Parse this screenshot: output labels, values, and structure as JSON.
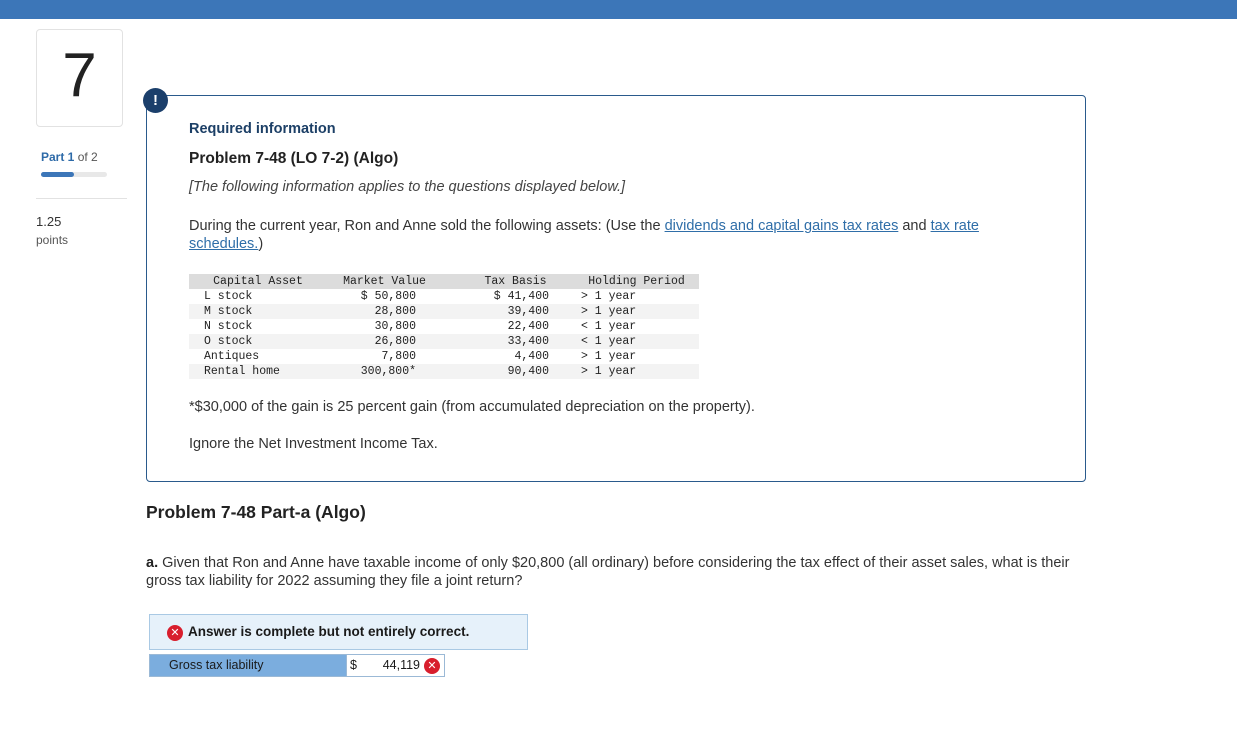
{
  "header": {
    "accent_color": "#3c76b8"
  },
  "sidebar": {
    "question_number": "7",
    "part_word": "Part 1",
    "part_of": "of 2",
    "progress_fraction": 0.5,
    "points_value": "1.25",
    "points_unit": "points"
  },
  "info": {
    "alert_symbol": "!",
    "required_title": "Required information",
    "problem_title": "Problem 7-48 (LO 7-2) (Algo)",
    "applies_note": "[The following information applies to the questions displayed below.]",
    "intro_before": "During the current year, Ron and Anne sold the following assets: (Use the ",
    "link_rates": "dividends and capital gains tax rates",
    "intro_between": " and ",
    "link_schedules": "tax rate schedules.",
    "intro_after": ")",
    "table": {
      "headers": [
        "Capital Asset",
        "Market Value",
        "Tax Basis",
        "Holding Period"
      ],
      "rows": [
        [
          "L stock",
          "$ 50,800",
          "$ 41,400",
          "> 1 year"
        ],
        [
          "M stock",
          "28,800",
          "39,400",
          "> 1 year"
        ],
        [
          "N stock",
          "30,800",
          "22,400",
          "< 1 year"
        ],
        [
          "O stock",
          "26,800",
          "33,400",
          "< 1 year"
        ],
        [
          "Antiques",
          "7,800",
          "4,400",
          "> 1 year"
        ],
        [
          "Rental home",
          "300,800*",
          "90,400",
          "> 1 year"
        ]
      ]
    },
    "footnote": "*$30,000 of the gain is 25 percent gain (from accumulated depreciation on the property).",
    "niit_note": "Ignore the Net Investment Income Tax."
  },
  "part": {
    "title": "Problem 7-48 Part-a (Algo)",
    "question_letter": "a.",
    "question_body": " Given that Ron and Anne have taxable income of only $20,800 (all ordinary) before considering the tax effect of their asset sales, what is their gross tax liability for 2022 assuming they file a joint return?"
  },
  "result": {
    "status_icon": "x-circle-icon",
    "status_symbol": "✕",
    "status_text": "Answer is complete but not entirely correct.",
    "status_color": "#d81e2d"
  },
  "answer": {
    "label": "Gross tax liability",
    "currency": "$",
    "value": "44,119",
    "error_symbol": "✕"
  }
}
